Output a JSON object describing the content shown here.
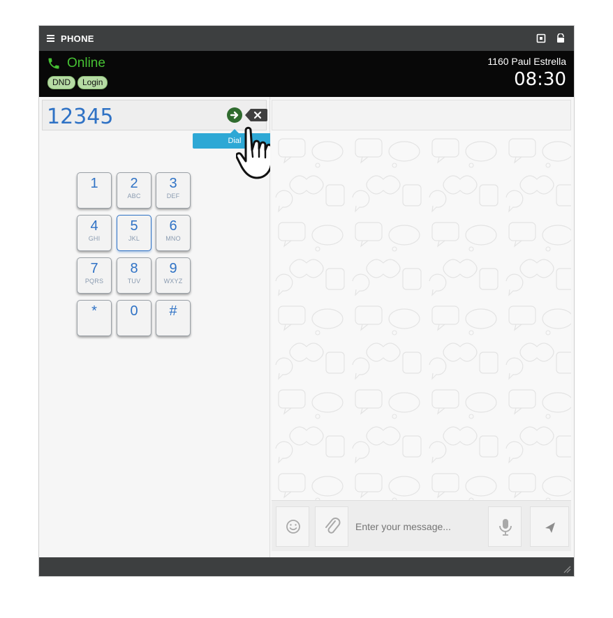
{
  "window": {
    "title": "PHONE",
    "icons": [
      "hamburger-menu-icon",
      "window-box-icon",
      "lock-icon"
    ]
  },
  "status": {
    "state": "Online",
    "dnd_label": "DND",
    "login_label": "Login",
    "user": "1160 Paul Estrella",
    "time": "08:30",
    "online_color": "#46c233"
  },
  "dialer": {
    "number": "12345",
    "tooltip": "Dial",
    "keys": [
      {
        "digit": "1",
        "letters": ""
      },
      {
        "digit": "2",
        "letters": "ABC"
      },
      {
        "digit": "3",
        "letters": "DEF"
      },
      {
        "digit": "4",
        "letters": "GHI"
      },
      {
        "digit": "5",
        "letters": "JKL"
      },
      {
        "digit": "6",
        "letters": "MNO"
      },
      {
        "digit": "7",
        "letters": "PQRS"
      },
      {
        "digit": "8",
        "letters": "TUV"
      },
      {
        "digit": "9",
        "letters": "WXYZ"
      },
      {
        "digit": "*",
        "letters": ""
      },
      {
        "digit": "0",
        "letters": ""
      },
      {
        "digit": "#",
        "letters": ""
      }
    ]
  },
  "chat": {
    "placeholder": "Enter your message..."
  }
}
